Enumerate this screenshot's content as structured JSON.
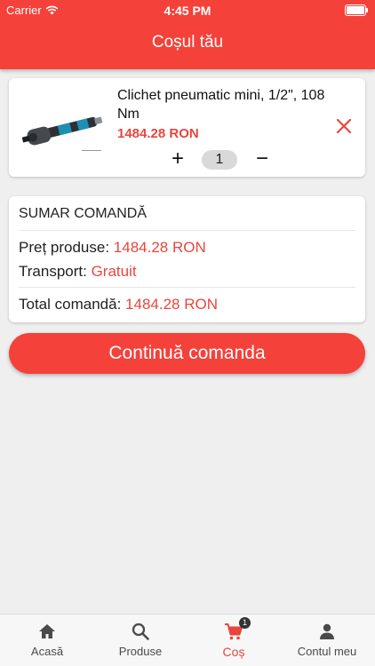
{
  "status_bar": {
    "carrier": "Carrier",
    "time": "4:45 PM"
  },
  "header": {
    "title": "Coșul tău"
  },
  "cart_item": {
    "name": "Clichet pneumatic mini, 1/2\", 108 Nm",
    "price": "1484.28 RON",
    "quantity": "1",
    "plus_label": "+",
    "minus_label": "−"
  },
  "summary": {
    "title": "SUMAR COMANDĂ",
    "products_label": "Preț produse:",
    "products_value": "1484.28 RON",
    "transport_label": "Transport:",
    "transport_value": "Gratuit",
    "total_label": "Total comandă:",
    "total_value": "1484.28 RON"
  },
  "cta": {
    "label": "Continuă comanda"
  },
  "tabs": [
    {
      "label": "Acasă",
      "icon": "home-icon"
    },
    {
      "label": "Produse",
      "icon": "search-icon"
    },
    {
      "label": "Coș",
      "icon": "cart-icon",
      "badge": "1",
      "active": true
    },
    {
      "label": "Contul meu",
      "icon": "user-icon"
    }
  ],
  "colors": {
    "accent": "#f4413a",
    "price": "#e8463d",
    "background": "#efefef"
  }
}
